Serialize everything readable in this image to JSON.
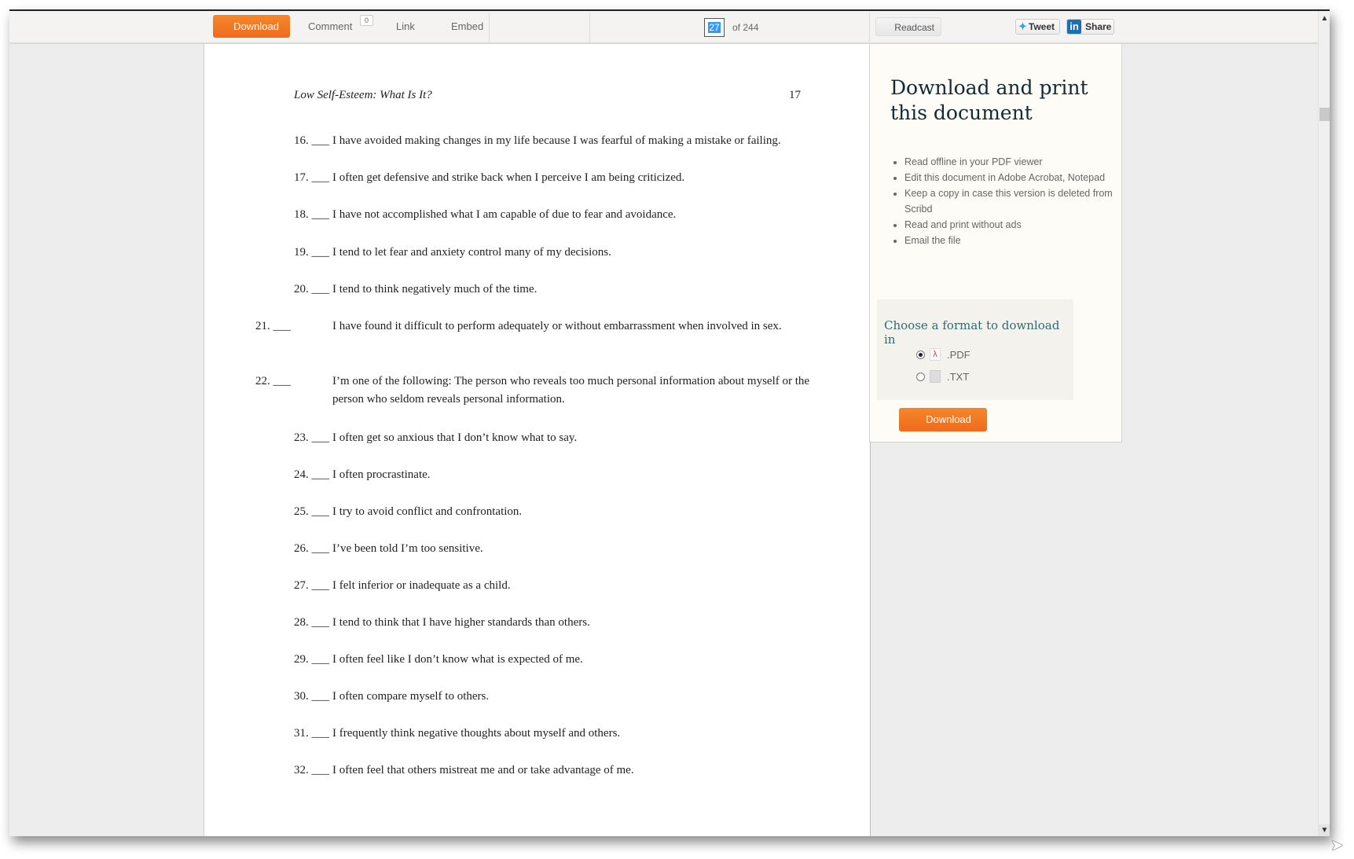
{
  "toolbar": {
    "download_label": "Download",
    "comment_label": "Comment",
    "comment_count": "0",
    "link_label": "Link",
    "embed_label": "Embed",
    "page_current": "27",
    "page_total_label": "of 244",
    "readcast_label": "Readcast",
    "tweet_label": "Tweet",
    "share_label": "Share",
    "icons": {
      "tweet": "twitter-bird-icon",
      "share": "linkedin-icon"
    }
  },
  "document": {
    "running_header": "Low Self-Esteem: What Is It?",
    "page_number": "17",
    "items": [
      {
        "num": "16. ___",
        "text": "I have avoided making changes in my life because I was fearful of making a mistake or failing."
      },
      {
        "num": "17. ___",
        "text": "I often get defensive and strike back when I  perceive I am being criticized."
      },
      {
        "num": "18. ___",
        "text": "I have not accomplished what I am capable of due to fear and avoidance."
      },
      {
        "num": "19. ___",
        "text": "I tend to let fear and anxiety control many of my decisions."
      },
      {
        "num": "20. ___",
        "text": "I tend to think negatively much of the time."
      },
      {
        "num": "21. ___",
        "text": "I have found it difficult to perform adequately or without embarrassment when involved in sex."
      },
      {
        "num": "22. ___",
        "text": "I’m one of the following: The person who reveals too much personal information about myself or the person who seldom reveals personal information."
      },
      {
        "num": "23. ___",
        "text": "I often get so anxious that I don’t know what to say."
      },
      {
        "num": "24. ___",
        "text": "I often procrastinate."
      },
      {
        "num": "25. ___",
        "text": "I try to avoid conflict and confrontation."
      },
      {
        "num": "26. ___",
        "text": "I’ve been told I’m too sensitive."
      },
      {
        "num": "27. ___",
        "text": "I felt inferior or inadequate as a child."
      },
      {
        "num": "28. ___",
        "text": "I tend to think that I have higher standards than others."
      },
      {
        "num": "29. ___",
        "text": "I often feel like I don’t know what is expected of me."
      },
      {
        "num": "30. ___",
        "text": "I often compare myself to others."
      },
      {
        "num": "31. ___",
        "text": "I frequently think negative thoughts about myself and others."
      },
      {
        "num": "32. ___",
        "text": "I often feel that others mistreat me and or take advantage of me."
      }
    ]
  },
  "panel": {
    "title": "Download and print this document",
    "benefits": [
      "Read offline in your PDF viewer",
      "Edit this document in Adobe Acrobat, Notepad",
      "Keep a copy in case this version is deleted from Scribd",
      "Read and print without ads",
      "Email the file"
    ],
    "format_title": "Choose a format to download in",
    "formats": [
      {
        "label": ".PDF",
        "selected": true,
        "icon": "pdf-file-icon"
      },
      {
        "label": ".TXT",
        "selected": false,
        "icon": "text-file-icon"
      }
    ],
    "download_label": "Download"
  },
  "colors": {
    "accent_orange": "#f0741f",
    "panel_title": "#102a36",
    "format_title": "#2f6b73"
  }
}
